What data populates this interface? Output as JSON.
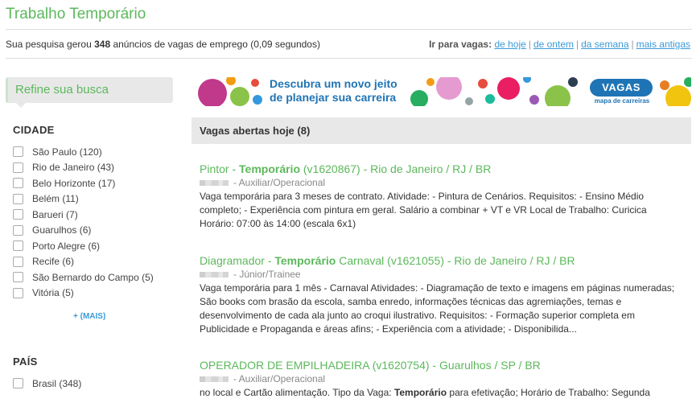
{
  "header": {
    "title": "Trabalho Temporário",
    "results_prefix": "Sua pesquisa gerou ",
    "results_count": "348",
    "results_suffix": " anúncios de vagas de emprego (0,09 segundos)",
    "goto_label": "Ir para vagas:",
    "goto_links": [
      "de hoje",
      "de ontem",
      "da semana",
      "mais antigas"
    ]
  },
  "sidebar": {
    "refine_label": "Refine sua busca",
    "city_title": "CIDADE",
    "cities": [
      "São Paulo (120)",
      "Rio de Janeiro (43)",
      "Belo Horizonte (17)",
      "Belém (11)",
      "Barueri (7)",
      "Guarulhos (6)",
      "Porto Alegre (6)",
      "Recife (6)",
      "São Bernardo do Campo (5)",
      "Vitória (5)"
    ],
    "more_label": "+ (MAIS)",
    "country_title": "PAÍS",
    "countries": [
      "Brasil (348)"
    ]
  },
  "banner": {
    "line1": "Descubra um novo jeito",
    "line2": "de planejar sua carreira",
    "logo": "VAGAS",
    "logo_sub": "mapa de carreiras"
  },
  "section": {
    "title": "Vagas abertas hoje (8)"
  },
  "jobs": [
    {
      "title_a": "Pintor - ",
      "title_b": "Temporário",
      "title_c": " (v1620867) - Rio de Janeiro / RJ / BR",
      "level": "- Auxiliar/Operacional",
      "desc": "Vaga temporária para 3 meses de contrato.   Atividade: - Pintura de Cenários.   Requisitos: - Ensino Médio completo; - Experiência com pintura em geral.   Salário a combinar + VT e VR Local de Trabalho: Curicica Horário: 07:00 às 14:00 (escala 6x1)"
    },
    {
      "title_a": "Diagramador - ",
      "title_b": "Temporário",
      "title_c": " Carnaval (v1621055) - Rio de Janeiro / RJ / BR",
      "level": "- Júnior/Trainee",
      "desc": "Vaga temporária para 1 mês - Carnaval   Atividades: - Diagramação de texto e imagens em páginas numeradas; São books com brasão da escola, samba enredo, informações técnicas das agremiações, temas e desenvolvimento de cada ala junto ao croqui ilustrativo.   Requisitos: - Formação superior completa em Publicidade e Propaganda e áreas afins; - Experiência com a atividade; - Disponibilida..."
    },
    {
      "title_a": "OPERADOR DE EMPILHADEIRA (v1620754) - Guarulhos / SP / BR",
      "title_b": "",
      "title_c": "",
      "level": "- Auxiliar/Operacional",
      "desc_a": "no local e Cartão alimentação. Tipo da Vaga: ",
      "desc_b": "Temporário",
      "desc_c": " para efetivação; Horário de Trabalho: Segunda"
    }
  ]
}
